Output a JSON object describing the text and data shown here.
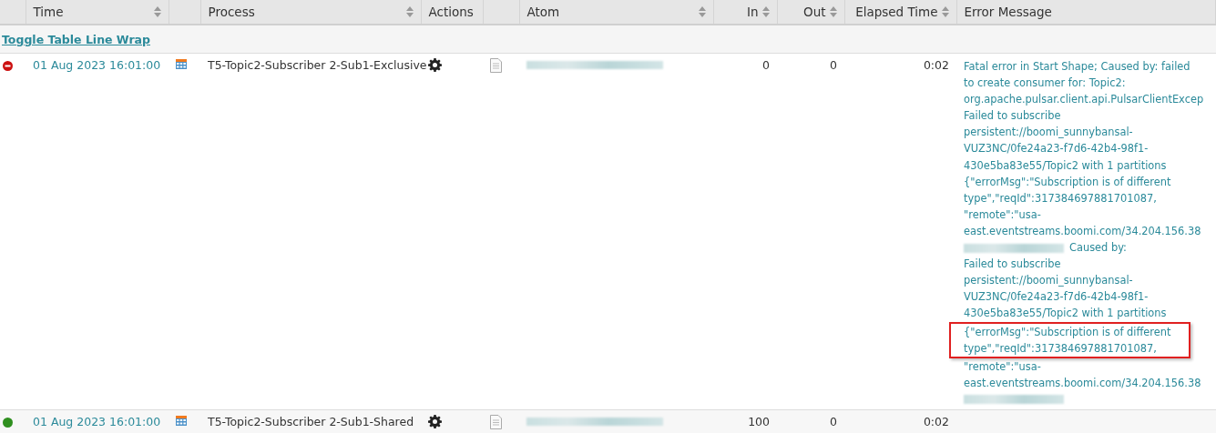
{
  "columns": [
    {
      "sortable": false
    },
    {
      "label": "Time",
      "sortable": true
    },
    {
      "sortable": false
    },
    {
      "label": "Process",
      "sortable": true
    },
    {
      "label": "Actions",
      "sortable": false
    },
    {
      "sortable": false
    },
    {
      "label": "Atom",
      "sortable": true
    },
    {
      "label": "In",
      "sortable": true
    },
    {
      "label": "Out",
      "sortable": true
    },
    {
      "label": "Elapsed Time",
      "sortable": true
    },
    {
      "label": "Error Message",
      "sortable": false
    }
  ],
  "toggle_link": "Toggle Table Line Wrap",
  "rows": [
    {
      "kind": "error",
      "time": "01 Aug 2023 16:01:00",
      "process": "T5-Topic2-Subscriber 2-Sub1-Exclusive",
      "in": "0",
      "out": "0",
      "elapsed": "0:02",
      "error_lines": [
        {
          "parts": [
            {
              "kind": "text",
              "text": "Fatal error in Start Shape; Caused by: failed"
            }
          ],
          "highlighted": false
        },
        {
          "parts": [
            {
              "kind": "text",
              "text": "to create consumer for: Topic2:"
            }
          ],
          "highlighted": false
        },
        {
          "parts": [
            {
              "kind": "text",
              "text": "org.apache.pulsar.client.api.PulsarClientExcep"
            }
          ],
          "highlighted": false
        },
        {
          "parts": [
            {
              "kind": "text",
              "text": "Failed to subscribe"
            }
          ],
          "highlighted": false
        },
        {
          "parts": [
            {
              "kind": "text",
              "text": "persistent://boomi_sunnybansal-"
            }
          ],
          "highlighted": false
        },
        {
          "parts": [
            {
              "kind": "text",
              "text": "VUZ3NC/0fe24a23-f7d6-42b4-98f1-"
            }
          ],
          "highlighted": false
        },
        {
          "parts": [
            {
              "kind": "text",
              "text": "430e5ba83e55/Topic2 with 1 partitions"
            }
          ],
          "highlighted": false
        },
        {
          "parts": [
            {
              "kind": "text",
              "text": "{\"errorMsg\":\"Subscription is of different"
            }
          ],
          "highlighted": false
        },
        {
          "parts": [
            {
              "kind": "text",
              "text": "type\",\"reqId\":317384697881701087,"
            }
          ],
          "highlighted": false
        },
        {
          "parts": [
            {
              "kind": "text",
              "text": "\"remote\":\"usa-"
            }
          ],
          "highlighted": false
        },
        {
          "parts": [
            {
              "kind": "text",
              "text": "east.eventstreams.boomi.com/34.204.156.38"
            }
          ],
          "highlighted": false
        },
        {
          "parts": [
            {
              "kind": "blur"
            },
            {
              "kind": "text",
              "text": "Caused by:"
            }
          ],
          "highlighted": false
        },
        {
          "parts": [
            {
              "kind": "text",
              "text": "Failed to subscribe"
            }
          ],
          "highlighted": false
        },
        {
          "parts": [
            {
              "kind": "text",
              "text": "persistent://boomi_sunnybansal-"
            }
          ],
          "highlighted": false
        },
        {
          "parts": [
            {
              "kind": "text",
              "text": "VUZ3NC/0fe24a23-f7d6-42b4-98f1-"
            }
          ],
          "highlighted": false
        },
        {
          "parts": [
            {
              "kind": "text",
              "text": "430e5ba83e55/Topic2 with 1 partitions"
            }
          ],
          "highlighted": false
        },
        {
          "parts": [
            {
              "kind": "text",
              "text": "{\"errorMsg\":\"Subscription is of different"
            }
          ],
          "highlighted": true
        },
        {
          "parts": [
            {
              "kind": "text",
              "text": "type\",\"reqId\":317384697881701087,"
            }
          ],
          "highlighted": true
        },
        {
          "parts": [
            {
              "kind": "text",
              "text": "\"remote\":\"usa-"
            }
          ],
          "highlighted": false
        },
        {
          "parts": [
            {
              "kind": "text",
              "text": "east.eventstreams.boomi.com/34.204.156.38"
            }
          ],
          "highlighted": false
        },
        {
          "parts": [
            {
              "kind": "blur"
            }
          ],
          "highlighted": false
        }
      ]
    },
    {
      "kind": "success",
      "time": "01 Aug 2023 16:01:00",
      "process": "T5-Topic2-Subscriber 2-Sub1-Shared",
      "in": "100",
      "out": "0",
      "elapsed": "0:02",
      "error_lines": []
    }
  ]
}
